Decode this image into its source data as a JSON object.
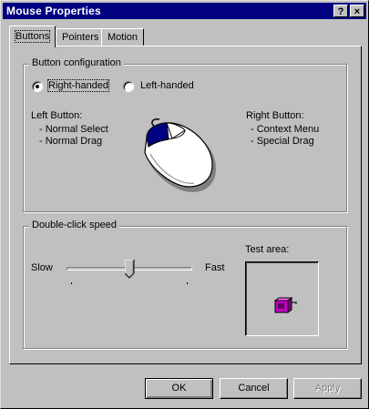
{
  "window": {
    "title": "Mouse Properties",
    "help_label": "?",
    "close_label": "×"
  },
  "tabs": [
    {
      "label": "Buttons",
      "active": true
    },
    {
      "label": "Pointers",
      "active": false
    },
    {
      "label": "Motion",
      "active": false
    }
  ],
  "button_configuration": {
    "group_label": "Button configuration",
    "right_handed_label": "Right-handed",
    "left_handed_label": "Left-handed",
    "selected": "right-handed",
    "left_button": {
      "heading": "Left Button:",
      "items": [
        "-  Normal Select",
        "-  Normal Drag"
      ]
    },
    "right_button": {
      "heading": "Right Button:",
      "items": [
        "-  Context Menu",
        "-  Special Drag"
      ]
    }
  },
  "double_click": {
    "group_label": "Double-click speed",
    "slow_label": "Slow",
    "fast_label": "Fast",
    "slider_value_fraction": 0.5,
    "test_area_label": "Test area:"
  },
  "buttons": {
    "ok": "OK",
    "cancel": "Cancel",
    "apply": "Apply",
    "apply_disabled": true
  },
  "colors": {
    "titlebar": "#000080",
    "face": "#c0c0c0",
    "mouse_button_highlight": "#000080",
    "test_box": "#c000c0"
  }
}
